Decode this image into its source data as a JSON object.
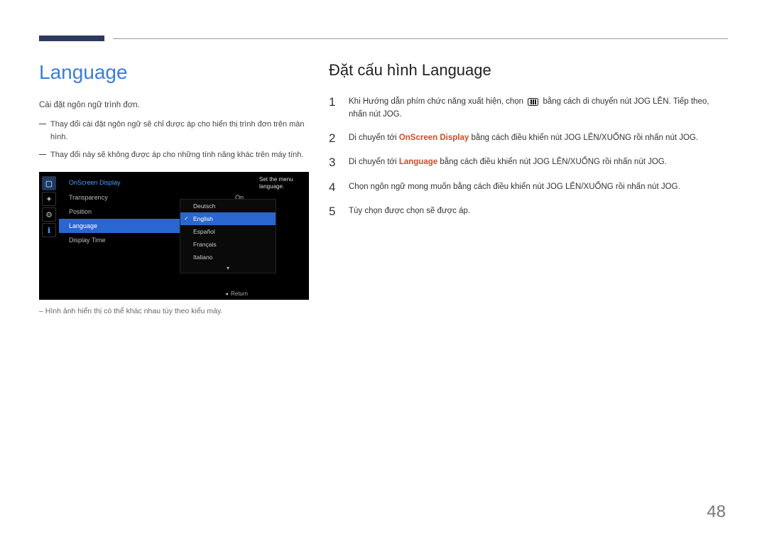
{
  "left": {
    "heading": "Language",
    "intro": "Cài đặt ngôn ngữ trình đơn.",
    "notes": [
      "Thay đổi cài đặt ngôn ngữ sẽ chỉ được áp cho hiển thị trình đơn trên màn hình.",
      "Thay đổi này sẽ không được áp cho những tính năng khác trên máy tính."
    ],
    "footnote": "Hình ảnh hiển thị có thể khác nhau tùy theo kiểu máy."
  },
  "osd": {
    "title": "OnScreen Display",
    "help": "Set the menu language.",
    "items": [
      {
        "label": "Transparency",
        "value": "On"
      },
      {
        "label": "Position",
        "value": ""
      },
      {
        "label": "Language",
        "value": ""
      },
      {
        "label": "Display Time",
        "value": ""
      }
    ],
    "selected_index": 2,
    "popup": [
      "Deutsch",
      "English",
      "Español",
      "Français",
      "Italiano"
    ],
    "popup_selected": 1,
    "return": "Return"
  },
  "right": {
    "heading": "Đặt cấu hình Language",
    "steps": {
      "s1a": "Khi Hướng dẫn phím chức năng xuất hiện, chọn ",
      "s1b": " bằng cách di chuyển nút JOG LÊN. Tiếp theo, nhấn nút JOG.",
      "s2a": "Di chuyển tới ",
      "s2hl": "OnScreen Display",
      "s2b": " bằng cách điều khiển nút JOG LÊN/XUỐNG rồi nhấn nút JOG.",
      "s3a": "Di chuyển tới ",
      "s3hl": "Language",
      "s3b": " bằng cách điều khiển nút JOG LÊN/XUỐNG rồi nhấn nút JOG.",
      "s4": "Chọn ngôn ngữ mong muốn bằng cách điều khiển nút JOG LÊN/XUỐNG rồi nhấn nút JOG.",
      "s5": "Tùy chọn được chọn sẽ được áp."
    }
  },
  "page_number": "48"
}
